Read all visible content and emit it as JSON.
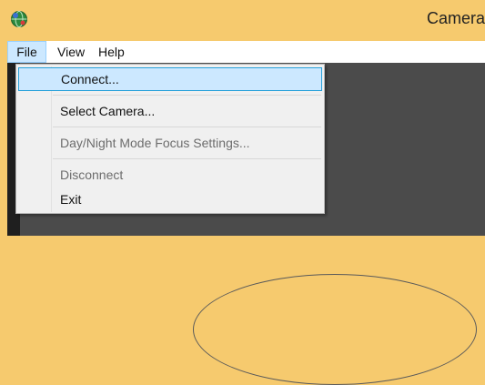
{
  "window": {
    "title": "Camera"
  },
  "menubar": {
    "items": [
      {
        "label": "File"
      },
      {
        "label": "View"
      },
      {
        "label": "Help"
      }
    ]
  },
  "file_menu": {
    "items": [
      {
        "label": "Connect...",
        "state": "highlighted"
      },
      {
        "label": "Select Camera...",
        "state": "enabled"
      },
      {
        "label": "Day/Night Mode Focus Settings...",
        "state": "disabled"
      },
      {
        "label": "Disconnect",
        "state": "disabled"
      },
      {
        "label": "Exit",
        "state": "enabled"
      }
    ]
  },
  "icons": {
    "app": "app-globe-icon"
  },
  "colors": {
    "titlebar": "#f6ca6e",
    "menu_highlight": "#cce8ff",
    "menu_highlight_border": "#26a0da",
    "viewport": "#4b4b4b"
  }
}
